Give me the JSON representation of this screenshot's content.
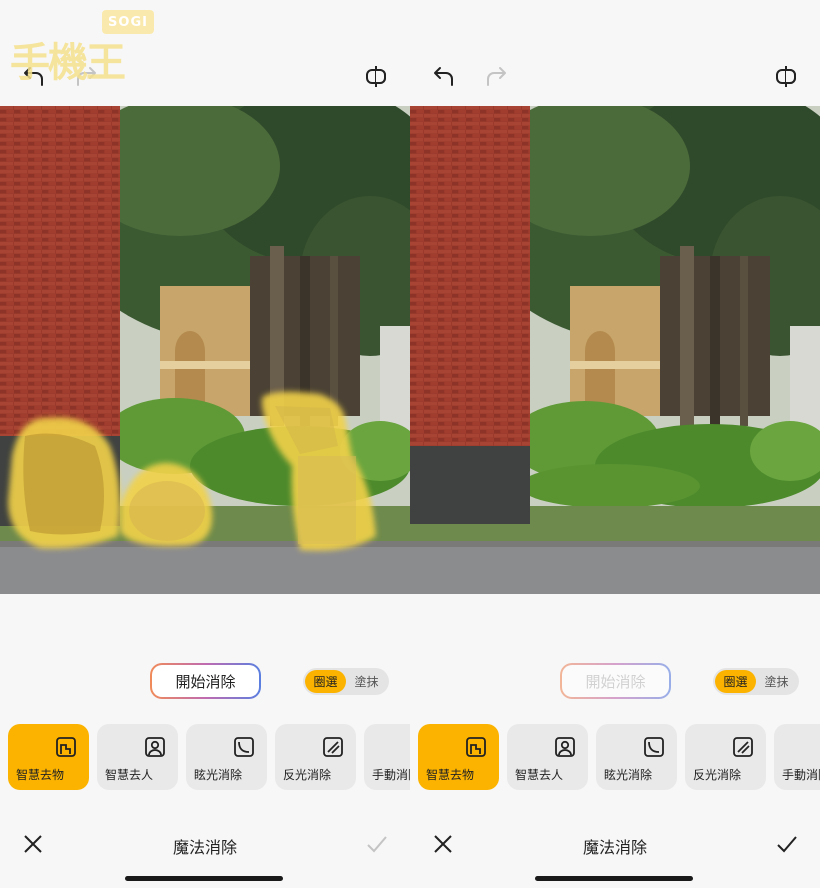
{
  "watermark": {
    "brand": "SOGI",
    "logo_text": "手機王"
  },
  "panels": [
    {
      "action": {
        "start_label": "開始消除",
        "start_enabled": true
      },
      "mode": {
        "options": [
          "圈選",
          "塗抹"
        ],
        "selected": "圈選"
      },
      "tools": [
        {
          "label": "智慧去物",
          "icon": "smart-remove-icon",
          "active": true
        },
        {
          "label": "智慧去人",
          "icon": "person-frame-icon",
          "active": false
        },
        {
          "label": "眩光消除",
          "icon": "glare-icon",
          "active": false
        },
        {
          "label": "反光消除",
          "icon": "reflection-icon",
          "active": false
        },
        {
          "label": "手動消除",
          "icon": "manual-erase-icon",
          "active": false
        }
      ],
      "bottom": {
        "title": "魔法消除",
        "confirm_enabled": false
      }
    },
    {
      "action": {
        "start_label": "開始消除",
        "start_enabled": false
      },
      "mode": {
        "options": [
          "圈選",
          "塗抹"
        ],
        "selected": "圈選"
      },
      "tools": [
        {
          "label": "智慧去物",
          "icon": "smart-remove-icon",
          "active": true
        },
        {
          "label": "智慧去人",
          "icon": "person-frame-icon",
          "active": false
        },
        {
          "label": "眩光消除",
          "icon": "glare-icon",
          "active": false
        },
        {
          "label": "反光消除",
          "icon": "reflection-icon",
          "active": false
        },
        {
          "label": "手動消除",
          "icon": "manual-erase-icon",
          "active": false
        }
      ],
      "bottom": {
        "title": "魔法消除",
        "confirm_enabled": true
      }
    }
  ],
  "colors": {
    "accent": "#fbb300",
    "selection_overlay": "#f2d24a",
    "disabled": "#c4c4c4"
  }
}
